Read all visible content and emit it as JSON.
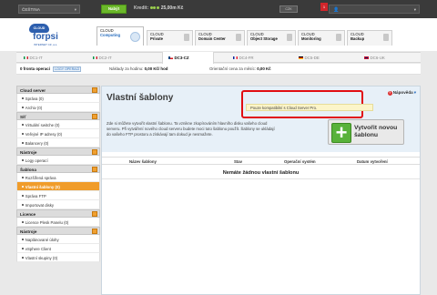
{
  "topbar": {
    "language": "ČEŠTINA",
    "recharge_button": "Nabýt",
    "credit_label": "Kredit:",
    "credit_value": "25,00m Kč",
    "currency_button": "CZK",
    "notifications_count": "1",
    "colors": {
      "background": "#3a3a3a",
      "accent": "#6bb82a",
      "alert": "#d2262b"
    }
  },
  "logo": {
    "badge": "CLOUD",
    "name": "forpsi",
    "subtitle": "INTERNET CZ, a.s."
  },
  "service_tabs": [
    {
      "line1": "CLOUD",
      "line2": "Computing",
      "icon": "cloud-icon",
      "active": true
    },
    {
      "line1": "CLOUD",
      "line2": "Private",
      "icon": "server-icon",
      "active": false
    },
    {
      "line1": "CLOUD",
      "line2": "Domain Center",
      "icon": "globe-icon",
      "active": false
    },
    {
      "line1": "CLOUD",
      "line2": "Object Storage",
      "icon": "storage-icon",
      "active": false
    },
    {
      "line1": "CLOUD",
      "line2": "Monitoring",
      "icon": "monitor-icon",
      "active": false
    },
    {
      "line1": "CLOUD",
      "line2": "Backup",
      "icon": "backup-icon",
      "active": false
    }
  ],
  "datacenters": [
    {
      "label": "DC1-IT",
      "flag": [
        "#009246",
        "#ffffff",
        "#ce2b37"
      ],
      "active": false
    },
    {
      "label": "DC2-IT",
      "flag": [
        "#009246",
        "#ffffff",
        "#ce2b37"
      ],
      "active": false
    },
    {
      "label": "DC3-CZ",
      "flag": [
        "#ffffff",
        "#d7141a",
        "#11457e"
      ],
      "active": true
    },
    {
      "label": "DC4-FR",
      "flag": [
        "#002395",
        "#ffffff",
        "#ed2939"
      ],
      "active": false
    },
    {
      "label": "DC5-DE",
      "flag": [
        "#000000",
        "#dd0000",
        "#ffce00"
      ],
      "active": false
    },
    {
      "label": "DC6-UK",
      "flag": [
        "#012169",
        "#c8102e",
        "#012169"
      ],
      "active": false
    }
  ],
  "stats": {
    "queue": "0 fronta operací",
    "queue_button": "LOGY OPERACÍ",
    "hourly_label": "Náklady za hodinu:",
    "hourly_value": "0,00 Kč/ hod",
    "monthly_label": "Orientační cena za měsíc:",
    "monthly_value": "0,00 Kč"
  },
  "sidebar": [
    {
      "title": "Cloud server",
      "items": [
        {
          "label": "Správa (0)",
          "selected": false
        },
        {
          "label": "Archiv (0)",
          "selected": false
        }
      ]
    },
    {
      "title": "Síť",
      "items": [
        {
          "label": "Virtuální switche (0)",
          "selected": false
        },
        {
          "label": "Veřejné IP adresy (0)",
          "selected": false
        },
        {
          "label": "Balancery (0)",
          "selected": false
        }
      ]
    },
    {
      "title": "Nástroje",
      "items": [
        {
          "label": "Logy operací",
          "selected": false
        }
      ]
    },
    {
      "title": "Šablona",
      "items": [
        {
          "label": "Rozšířená správa",
          "selected": false
        },
        {
          "label": "Vlastní šablony (0)",
          "selected": true
        },
        {
          "label": "Správa FTP",
          "selected": false
        },
        {
          "label": "Importovat disky",
          "selected": false
        }
      ]
    },
    {
      "title": "Licence",
      "items": [
        {
          "label": "Licence Plesk Panelu (0)",
          "selected": false
        }
      ]
    },
    {
      "title": "Nástroje",
      "items": [
        {
          "label": "Naplánované úlohy",
          "selected": false
        },
        {
          "label": "vSphere Client",
          "selected": false
        },
        {
          "label": "Vlastní skupiny (0)",
          "selected": false
        }
      ]
    }
  ],
  "main": {
    "title": "Vlastní šablony",
    "help": "Nápověda",
    "notice": "Pouze kompatibilní s Cloud Server Pro.",
    "description": "Zde si můžete vytvořit vlastní šablonu. Ta vznikne zkopírováním hlavního disku vašeho cloud serveru. Při vytváření nového cloud serveru budete moci tuto šablonu použít. Šablony se ukládají do vašeho FTP prostoru a získávají tam dokud je nesmažete.",
    "create_button": "Vytvořit novou šablonu",
    "columns": [
      "Název šablony",
      "Stav",
      "Operační systém",
      "Datum vytvoření"
    ],
    "empty_message": "Nemáte žádnou vlastní šablonu",
    "colors": {
      "panel_bg": "#e7f0f8",
      "highlight": "#e10d12",
      "create": "#58b23a",
      "selected": "#f09c2a"
    }
  }
}
